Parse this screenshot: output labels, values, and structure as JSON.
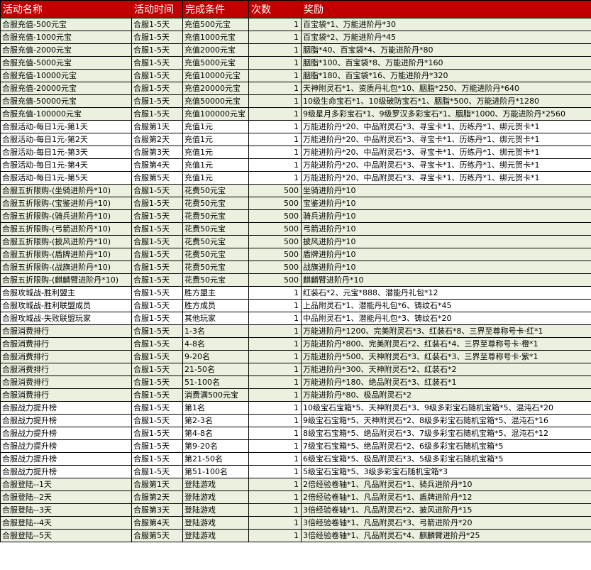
{
  "colors": {
    "header_bg": "#c00000",
    "header_text": "#ffffff",
    "green_row": "#ebf1de",
    "white_row": "#ffffff"
  },
  "headers": [
    "活动名称",
    "活动时间",
    "完成条件",
    "次数",
    "奖励"
  ],
  "rows": [
    {
      "name": "合服充值-500元宝",
      "time": "合服1-5天",
      "cond": "充值500元宝",
      "count": "1",
      "reward": "百宝袋*1、万能进阶丹*30",
      "bg": "g"
    },
    {
      "name": "合服充值-1000元宝",
      "time": "合服1-5天",
      "cond": "充值1000元宝",
      "count": "1",
      "reward": "百宝袋*2、万能进阶丹*45",
      "bg": "g"
    },
    {
      "name": "合服充值-2000元宝",
      "time": "合服1-5天",
      "cond": "充值2000元宝",
      "count": "1",
      "reward": "胭脂*40、百宝袋*4、万能进阶丹*80",
      "bg": "g"
    },
    {
      "name": "合服充值-5000元宝",
      "time": "合服1-5天",
      "cond": "充值5000元宝",
      "count": "1",
      "reward": "胭脂*100、百宝袋*8、万能进阶丹*160",
      "bg": "g"
    },
    {
      "name": "合服充值-10000元宝",
      "time": "合服1-5天",
      "cond": "充值10000元宝",
      "count": "1",
      "reward": "胭脂*180、百宝袋*16、万能进阶丹*320",
      "bg": "g"
    },
    {
      "name": "合服充值-20000元宝",
      "time": "合服1-5天",
      "cond": "充值20000元宝",
      "count": "1",
      "reward": "天神附灵石*1、资质丹礼包*10、胭脂*250、万能进阶丹*640",
      "bg": "g"
    },
    {
      "name": "合服充值-50000元宝",
      "time": "合服1-5天",
      "cond": "充值50000元宝",
      "count": "1",
      "reward": "10级生命宝石*1、10级破防宝石*1、胭脂*500、万能进阶丹*1280",
      "bg": "g"
    },
    {
      "name": "合服充值-100000元宝",
      "time": "合服1-5天",
      "cond": "充值100000元宝",
      "count": "1",
      "reward": "9级星月多彩宝石*1、9级罗汉多彩宝石*1、胭脂*1000、万能进阶丹*2560",
      "bg": "g"
    },
    {
      "name": "合服活动-每日1元-第1天",
      "time": "合服第1天",
      "cond": "充值1元",
      "count": "1",
      "reward": "万能进阶丹*20、中品附灵石*3、寻宝卡*1、历练丹*1、绑元贺卡*1",
      "bg": "w"
    },
    {
      "name": "合服活动-每日1元-第2天",
      "time": "合服第2天",
      "cond": "充值1元",
      "count": "1",
      "reward": "万能进阶丹*20、中品附灵石*3、寻宝卡*1、历练丹*1、绑元贺卡*1",
      "bg": "w"
    },
    {
      "name": "合服活动-每日1元-第3天",
      "time": "合服第3天",
      "cond": "充值1元",
      "count": "1",
      "reward": "万能进阶丹*20、中品附灵石*3、寻宝卡*1、历练丹*1、绑元贺卡*1",
      "bg": "w"
    },
    {
      "name": "合服活动-每日1元-第4天",
      "time": "合服第4天",
      "cond": "充值1元",
      "count": "1",
      "reward": "万能进阶丹*20、中品附灵石*3、寻宝卡*1、历练丹*1、绑元贺卡*1",
      "bg": "w"
    },
    {
      "name": "合服活动-每日1元-第5天",
      "time": "合服第5天",
      "cond": "充值1元",
      "count": "1",
      "reward": "万能进阶丹*20、中品附灵石*3、寻宝卡*1、历练丹*1、绑元贺卡*1",
      "bg": "w"
    },
    {
      "name": "合服五折限购-(坐骑进阶丹*10)",
      "time": "合服1-5天",
      "cond": "花费50元宝",
      "count": "500",
      "reward": "坐骑进阶丹*10",
      "bg": "g"
    },
    {
      "name": "合服五折限购-(宝鉴进阶丹*10)",
      "time": "合服1-5天",
      "cond": "花费50元宝",
      "count": "500",
      "reward": "宝鉴进阶丹*10",
      "bg": "g"
    },
    {
      "name": "合服五折限购-(骑兵进阶丹*10)",
      "time": "合服1-5天",
      "cond": "花费50元宝",
      "count": "500",
      "reward": "骑兵进阶丹*10",
      "bg": "g"
    },
    {
      "name": "合服五折限购-(弓箭进阶丹*10)",
      "time": "合服1-5天",
      "cond": "花费50元宝",
      "count": "500",
      "reward": "弓箭进阶丹*10",
      "bg": "g"
    },
    {
      "name": "合服五折限购-(披风进阶丹*10)",
      "time": "合服1-5天",
      "cond": "花费50元宝",
      "count": "500",
      "reward": "披风进阶丹*10",
      "bg": "g"
    },
    {
      "name": "合服五折限购-(盾牌进阶丹*10)",
      "time": "合服1-5天",
      "cond": "花费50元宝",
      "count": "500",
      "reward": "盾牌进阶丹*10",
      "bg": "g"
    },
    {
      "name": "合服五折限购-(战旗进阶丹*10)",
      "time": "合服1-5天",
      "cond": "花费50元宝",
      "count": "500",
      "reward": "战旗进阶丹*10",
      "bg": "g"
    },
    {
      "name": "合服五折限购-(麒麟臂进阶丹*10)",
      "time": "合服1-5天",
      "cond": "花费50元宝",
      "count": "500",
      "reward": "麒麟臂进阶丹*10",
      "bg": "g"
    },
    {
      "name": "合服攻城战-胜利盟主",
      "time": "合服1-5天",
      "cond": "胜方盟主",
      "count": "1",
      "reward": "红装石*2、元宝*888、潜能丹礼包*12",
      "bg": "w"
    },
    {
      "name": "合服攻城战-胜利联盟成员",
      "time": "合服1-5天",
      "cond": "胜方成员",
      "count": "1",
      "reward": "上品附灵石*1、潜能丹礼包*6、铸纹石*45",
      "bg": "w"
    },
    {
      "name": "合服攻城战-失败联盟玩家",
      "time": "合服1-5天",
      "cond": "其他玩家",
      "count": "1",
      "reward": "中品附灵石*1、潜能丹礼包*3、铸纹石*20",
      "bg": "w"
    },
    {
      "name": "合服消费排行",
      "time": "合服1-5天",
      "cond": "1-3名",
      "count": "1",
      "reward": "万能进阶丹*1200、完美附灵石*3、红装石*8、三界至尊称号卡·红*1",
      "bg": "g"
    },
    {
      "name": "合服消费排行",
      "time": "合服1-5天",
      "cond": "4-8名",
      "count": "1",
      "reward": "万能进阶丹*800、完美附灵石*2、红装石*4、三界至尊称号卡·橙*1",
      "bg": "g"
    },
    {
      "name": "合服消费排行",
      "time": "合服1-5天",
      "cond": "9-20名",
      "count": "1",
      "reward": "万能进阶丹*500、天神附灵石*3、红装石*3、三界至尊称号卡·紫*1",
      "bg": "g"
    },
    {
      "name": "合服消费排行",
      "time": "合服1-5天",
      "cond": "21-50名",
      "count": "1",
      "reward": "万能进阶丹*300、天神附灵石*2、红装石*2",
      "bg": "g"
    },
    {
      "name": "合服消费排行",
      "time": "合服1-5天",
      "cond": "51-100名",
      "count": "1",
      "reward": "万能进阶丹*180、绝品附灵石*3、红装石*1",
      "bg": "g"
    },
    {
      "name": "合服消费排行",
      "time": "合服1-5天",
      "cond": "消费满500元宝",
      "count": "1",
      "reward": "万能进阶丹*80、极品附灵石*2",
      "bg": "g"
    },
    {
      "name": "合服战力提升榜",
      "time": "合服1-5天",
      "cond": "第1名",
      "count": "1",
      "reward": "10级宝石宝箱*5、天神附灵石*3、9级多彩宝石随机宝箱*5、混沌石*20",
      "bg": "w"
    },
    {
      "name": "合服战力提升榜",
      "time": "合服1-5天",
      "cond": "第2-3名",
      "count": "1",
      "reward": "9级宝石宝箱*5、天神附灵石*2、8级多彩宝石随机宝箱*5、混沌石*16",
      "bg": "w"
    },
    {
      "name": "合服战力提升榜",
      "time": "合服1-5天",
      "cond": "第4-8名",
      "count": "1",
      "reward": "8级宝石宝箱*5、绝品附灵石*3、7级多彩宝石随机宝箱*5、混沌石*12",
      "bg": "w"
    },
    {
      "name": "合服战力提升榜",
      "time": "合服1-5天",
      "cond": "第9-20名",
      "count": "1",
      "reward": "7级宝石宝箱*5、绝品附灵石*2、6级多彩宝石随机宝箱*5",
      "bg": "w"
    },
    {
      "name": "合服战力提升榜",
      "time": "合服1-5天",
      "cond": "第21-50名",
      "count": "1",
      "reward": "6级宝石宝箱*5、极品附灵石*3、5级多彩宝石随机宝箱*5",
      "bg": "w"
    },
    {
      "name": "合服战力提升榜",
      "time": "合服1-5天",
      "cond": "第51-100名",
      "count": "1",
      "reward": "5级宝石宝箱*5、3级多彩宝石随机宝箱*3",
      "bg": "w"
    },
    {
      "name": "合服登陆--1天",
      "time": "合服第1天",
      "cond": "登陆游戏",
      "count": "1",
      "reward": "2倍经验卷轴*1、凡品附灵石*1、骑兵进阶丹*10",
      "bg": "g"
    },
    {
      "name": "合服登陆--2天",
      "time": "合服第2天",
      "cond": "登陆游戏",
      "count": "1",
      "reward": "2倍经验卷轴*1、凡品附灵石*1、盾牌进阶丹*12",
      "bg": "g"
    },
    {
      "name": "合服登陆--3天",
      "time": "合服第3天",
      "cond": "登陆游戏",
      "count": "1",
      "reward": "3倍经验卷轴*1、凡品附灵石*2、披风进阶丹*15",
      "bg": "g"
    },
    {
      "name": "合服登陆--4天",
      "time": "合服第4天",
      "cond": "登陆游戏",
      "count": "1",
      "reward": "3倍经验卷轴*1、凡品附灵石*3、弓箭进阶丹*20",
      "bg": "g"
    },
    {
      "name": "合服登陆--5天",
      "time": "合服第5天",
      "cond": "登陆游戏",
      "count": "1",
      "reward": "3倍经验卷轴*1、凡品附灵石*4、麒麟臂进阶丹*25",
      "bg": "g"
    }
  ]
}
